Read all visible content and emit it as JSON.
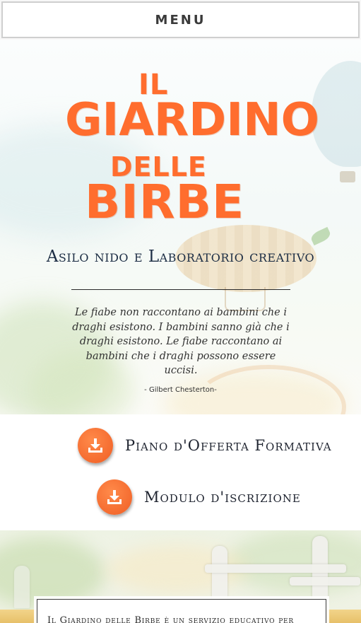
{
  "menu": {
    "label": "MENU"
  },
  "hero": {
    "logo": {
      "line1": "IL",
      "line2": "GIARDINO",
      "line3": "DELLE",
      "line4": "BIRBE"
    },
    "subtitle": "Asilo nido e Laboratorio creativo",
    "quote": "Le fiabe non raccontano ai bambini che i draghi esistono. I bambini sanno già che i draghi esistono. Le fiabe raccontano ai bambini che i draghi possono essere uccisi.",
    "quote_author": "- Gilbert Chesterton-"
  },
  "downloads": {
    "items": [
      {
        "label": "Piano d'Offerta Formativa",
        "icon": "download-icon"
      },
      {
        "label": "Modulo d'iscrizione",
        "icon": "download-icon"
      }
    ]
  },
  "info": {
    "text": "Il Giardino delle Birbe è un servizio educativo per"
  },
  "colors": {
    "accent": "#ff6d2e",
    "subtitle": "#1c2d44",
    "gold": "#e7c069"
  }
}
